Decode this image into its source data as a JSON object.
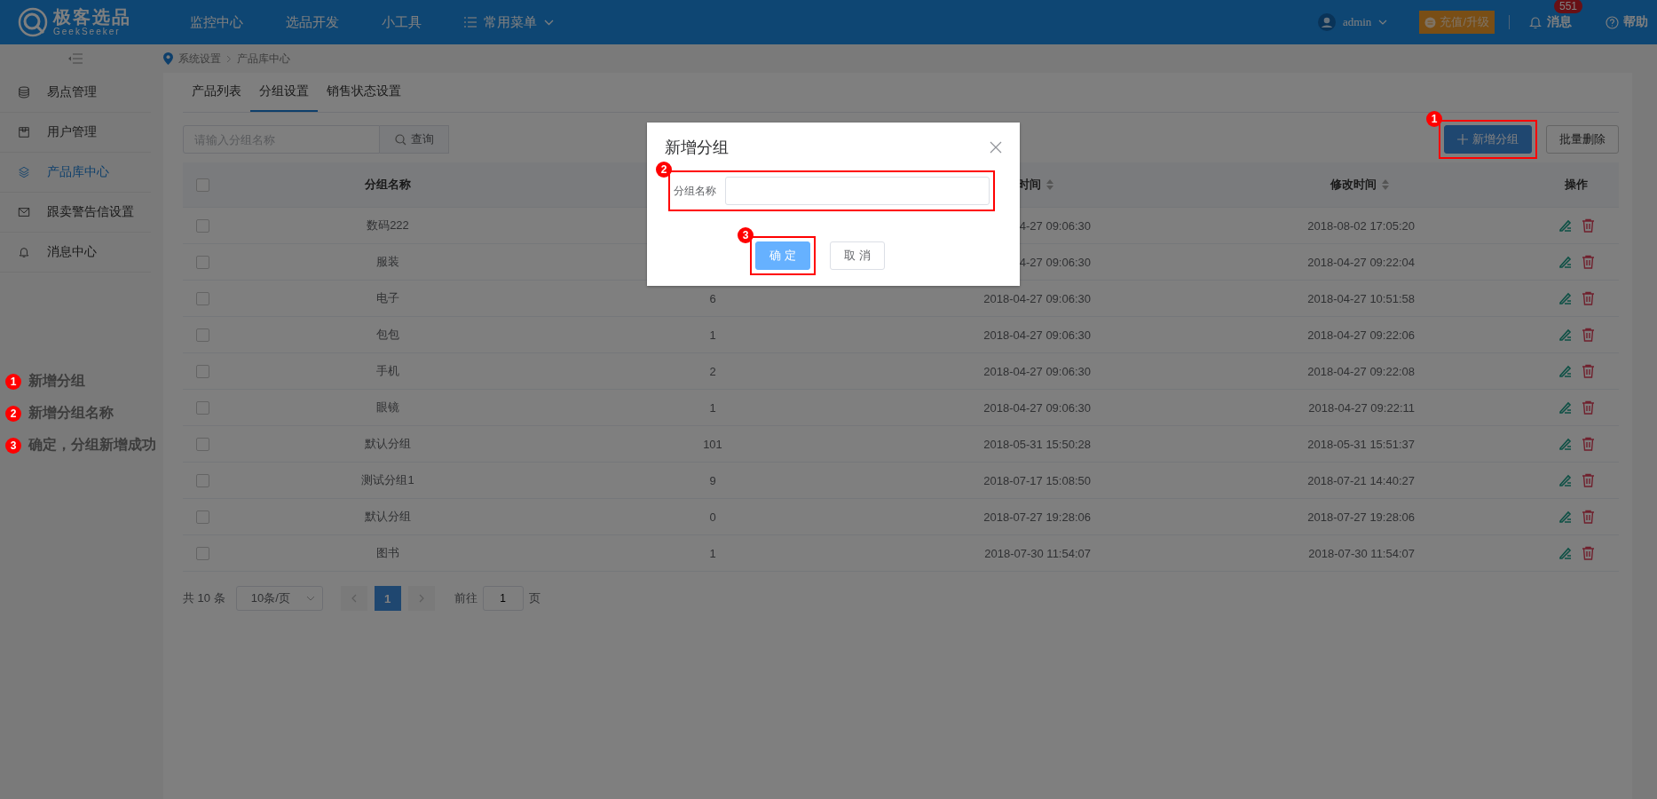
{
  "topbar": {
    "logo": {
      "title": "极客选品",
      "subtitle": "GeekSeeker"
    },
    "nav": [
      {
        "label": "监控中心",
        "kind": "link"
      },
      {
        "label": "选品开发",
        "kind": "link"
      },
      {
        "label": "小工具",
        "kind": "link"
      },
      {
        "label": "常用菜单",
        "kind": "dropdown"
      }
    ],
    "user": "admin",
    "upgrade": "充值/升级",
    "messages": {
      "label": "消息",
      "badge": "551"
    },
    "help": "帮助"
  },
  "sidebar": {
    "items": [
      {
        "label": "易点管理",
        "selected": false
      },
      {
        "label": "用户管理",
        "selected": false
      },
      {
        "label": "产品库中心",
        "selected": true
      },
      {
        "label": "跟卖警告信设置",
        "selected": false
      },
      {
        "label": "消息中心",
        "selected": false
      }
    ]
  },
  "annotations": [
    {
      "number": "1",
      "text": "新增分组"
    },
    {
      "number": "2",
      "text": "新增分组名称"
    },
    {
      "number": "3",
      "text": "确定，分组新增成功"
    }
  ],
  "breadcrumb": [
    "系统设置",
    "产品库中心"
  ],
  "tabs": [
    {
      "label": "产品列表",
      "selected": false
    },
    {
      "label": "分组设置",
      "selected": true
    },
    {
      "label": "销售状态设置",
      "selected": false
    }
  ],
  "search": {
    "placeholder": "请输入分组名称",
    "button": "查询"
  },
  "actions": [
    {
      "label": "新增分组",
      "kind": "primary",
      "step": "1"
    },
    {
      "label": "批量删除",
      "kind": "default"
    }
  ],
  "table": {
    "header_checked": false,
    "columns": [
      {
        "label": "分组名称",
        "sortable": false
      },
      null,
      {
        "label": "时间",
        "sortable": true
      },
      {
        "label": "修改时间",
        "sortable": true
      },
      {
        "label": "操作",
        "sortable": false
      }
    ],
    "rows": [
      {
        "checked": false,
        "cells": [
          "数码222",
          null,
          "4-27 09:06:30",
          "2018-08-02 17:05:20"
        ]
      },
      {
        "checked": false,
        "cells": [
          "服装",
          null,
          "4-27 09:06:30",
          "2018-04-27 09:22:04"
        ]
      },
      {
        "checked": false,
        "cells": [
          "电子",
          "6",
          "2018-04-27 09:06:30",
          "2018-04-27 10:51:58"
        ]
      },
      {
        "checked": false,
        "cells": [
          "包包",
          "1",
          "2018-04-27 09:06:30",
          "2018-04-27 09:22:06"
        ]
      },
      {
        "checked": false,
        "cells": [
          "手机",
          "2",
          "2018-04-27 09:06:30",
          "2018-04-27 09:22:08"
        ]
      },
      {
        "checked": false,
        "cells": [
          "眼镜",
          "1",
          "2018-04-27 09:06:30",
          "2018-04-27 09:22:11"
        ]
      },
      {
        "checked": false,
        "cells": [
          "默认分组",
          "101",
          "2018-05-31 15:50:28",
          "2018-05-31 15:51:37"
        ]
      },
      {
        "checked": false,
        "cells": [
          "测试分组1",
          "9",
          "2018-07-17 15:08:50",
          "2018-07-21 14:40:27"
        ]
      },
      {
        "checked": false,
        "cells": [
          "默认分组",
          "0",
          "2018-07-27 19:28:06",
          "2018-07-27 19:28:06"
        ]
      },
      {
        "checked": false,
        "cells": [
          "图书",
          "1",
          "2018-07-30 11:54:07",
          "2018-07-30 11:54:07"
        ]
      }
    ]
  },
  "pagination": {
    "total": "共 10 条",
    "page_size": "10条/页",
    "pages": [
      {
        "label": "1",
        "selected": true
      }
    ],
    "goto_label": "前往",
    "goto_value": "1",
    "goto_suffix": "页"
  },
  "dialog": {
    "title": "新增分组",
    "field": {
      "label": "分组名称",
      "step": "2"
    },
    "buttons": [
      {
        "label": "确 定",
        "kind": "primary",
        "step": "3"
      },
      {
        "label": "取 消",
        "kind": "default"
      }
    ]
  }
}
